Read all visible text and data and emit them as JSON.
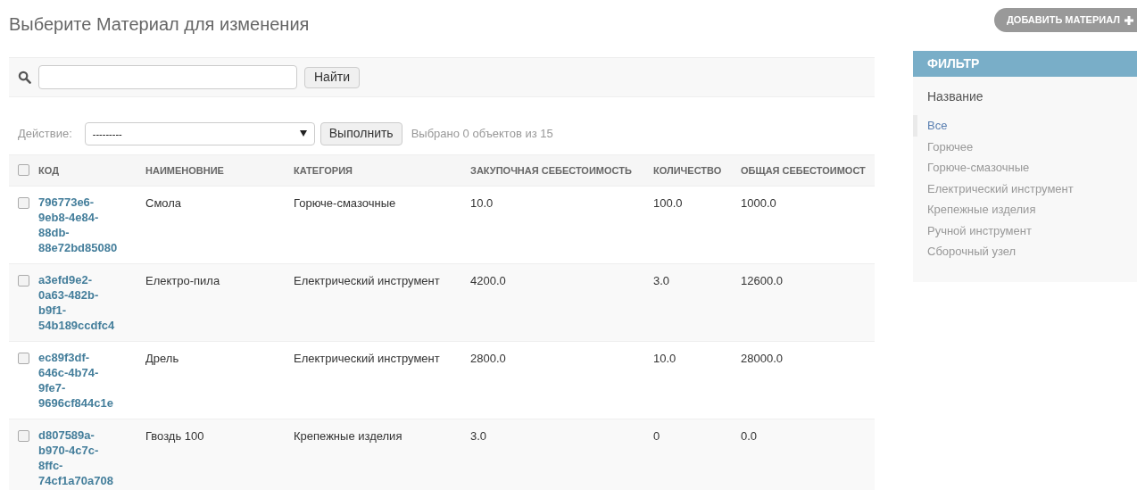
{
  "title": "Выберите Материал для изменения",
  "add_button": "ДОБАВИТЬ МАТЕРИАЛ",
  "search": {
    "button": "Найти"
  },
  "actions": {
    "label": "Действие:",
    "select": "---------",
    "button": "Выполнить",
    "counter": "Выбрано 0 объектов из 15"
  },
  "table": {
    "select_all_checked": false,
    "columns": [
      "КОД",
      "НАИМЕНОВНИЕ",
      "КАТЕГОРИЯ",
      "ЗАКУПОЧНАЯ СЕБЕСТОИМОСТЬ",
      "КОЛИЧЕСТВО",
      "ОБЩАЯ СЕБЕСТОИМОСТ"
    ],
    "rows": [
      {
        "checked": false,
        "cells": [
          "796773e6-9eb8-4e84-88db-88e72bd85080",
          "Смола",
          "Горюче-смазочные",
          "10.0",
          "100.0",
          "1000.0"
        ]
      },
      {
        "checked": false,
        "cells": [
          "a3efd9e2-0a63-482b-b9f1-54b189ccdfc4",
          "Електро-пила",
          "Електрический инструмент",
          "4200.0",
          "3.0",
          "12600.0"
        ]
      },
      {
        "checked": false,
        "cells": [
          "ec89f3df-646c-4b74-9fe7-9696cf844c1e",
          "Дрель",
          "Електрический инструмент",
          "2800.0",
          "10.0",
          "28000.0"
        ]
      },
      {
        "checked": false,
        "cells": [
          "d807589a-b970-4c7c-8ffc-74cf1a70a708",
          "Гвоздь 100",
          "Крепежные изделия",
          "3.0",
          "0",
          "0.0"
        ]
      }
    ]
  },
  "filter": {
    "title": "ФИЛЬТР",
    "heading": "Название",
    "items": [
      {
        "label": "Все",
        "selected": true
      },
      {
        "label": "Горючее",
        "selected": false
      },
      {
        "label": "Горюче-смазочные",
        "selected": false
      },
      {
        "label": "Електрический инструмент",
        "selected": false
      },
      {
        "label": "Крепежные изделия",
        "selected": false
      },
      {
        "label": "Ручной инструмент",
        "selected": false
      },
      {
        "label": "Сборочный узел",
        "selected": false
      }
    ]
  }
}
